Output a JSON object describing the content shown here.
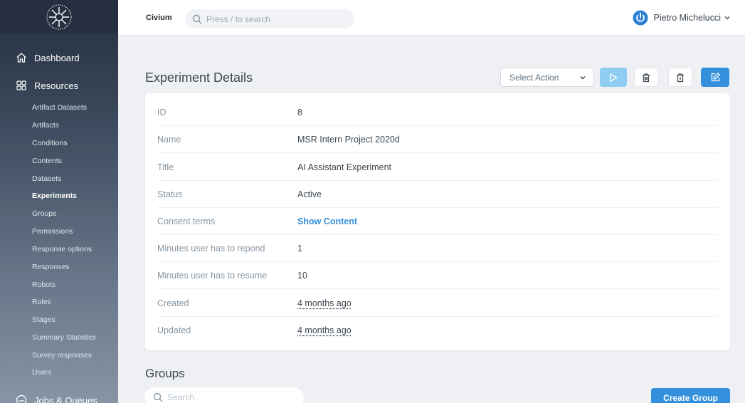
{
  "sidebar": {
    "dashboard_label": "Dashboard",
    "resources_label": "Resources",
    "items": [
      {
        "label": "Artifact Datasets"
      },
      {
        "label": "Artifacts"
      },
      {
        "label": "Conditions"
      },
      {
        "label": "Contents"
      },
      {
        "label": "Datasets"
      },
      {
        "label": "Experiments",
        "active": true
      },
      {
        "label": "Groups"
      },
      {
        "label": "Permissions"
      },
      {
        "label": "Response options"
      },
      {
        "label": "Responses"
      },
      {
        "label": "Robots"
      },
      {
        "label": "Roles"
      },
      {
        "label": "Stages"
      },
      {
        "label": "Summary Statistics"
      },
      {
        "label": "Survey responses"
      },
      {
        "label": "Users"
      }
    ],
    "jobs_label": "Jobs & Queues"
  },
  "header": {
    "brand": "Civium",
    "search_placeholder": "Press / to search",
    "user_name": "Pietro Michelucci"
  },
  "page": {
    "title": "Experiment Details",
    "select_action": "Select Action"
  },
  "details": [
    {
      "label": "ID",
      "value": "8"
    },
    {
      "label": "Name",
      "value": "MSR Intern Project 2020d"
    },
    {
      "label": "Title",
      "value": "AI Assistant Experiment"
    },
    {
      "label": "Status",
      "value": "Active"
    },
    {
      "label": "Consent terms",
      "value": "Show Content"
    },
    {
      "label": "Minutes user has to repond",
      "value": "1"
    },
    {
      "label": "Minutes user has to resume",
      "value": "10"
    },
    {
      "label": "Created",
      "value": "4 months ago"
    },
    {
      "label": "Updated",
      "value": "4 months ago"
    }
  ],
  "groups": {
    "title": "Groups",
    "search_placeholder": "Search",
    "create_label": "Create Group"
  },
  "colors": {
    "primary": "#3490dc",
    "primary_light": "#8fcdf3",
    "sidebar_dark": "#252f3f"
  }
}
